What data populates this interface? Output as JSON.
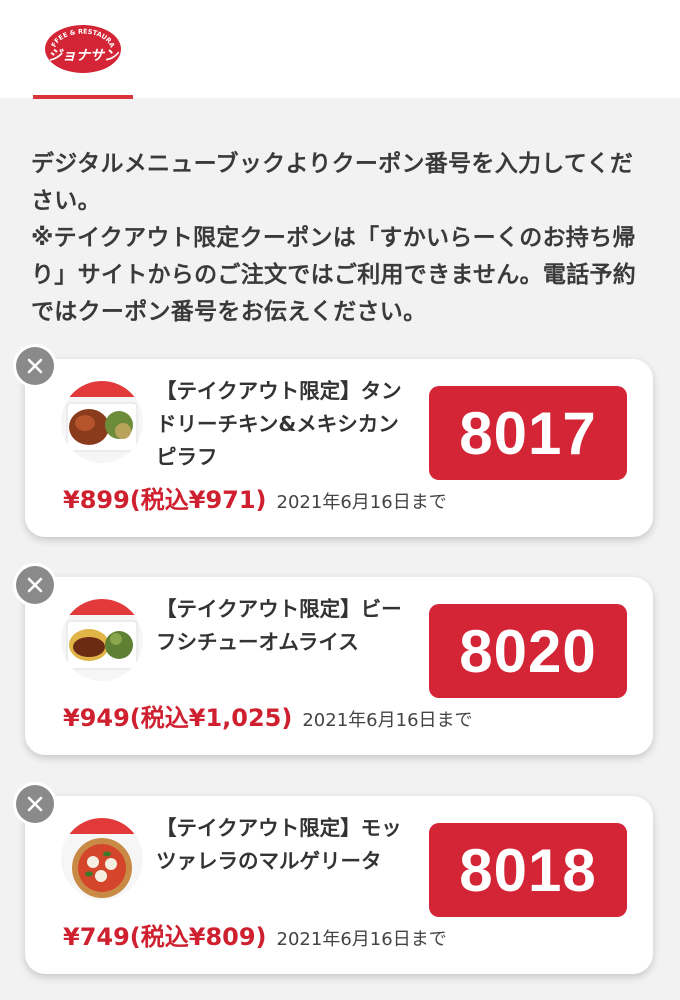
{
  "header": {
    "logo_top_text": "COFFEE & RESTAURANT",
    "logo_main_text": "ジョナサン"
  },
  "instructions": {
    "line1": "デジタルメニューブックよりクーポン番号を入力してください。",
    "line2": "※テイクアウト限定クーポンは「すかいらーくのお持ち帰り」サイトからのご注文ではご利用できません。電話予約ではクーポン番号をお伝えください。"
  },
  "coupons": [
    {
      "title": "【テイクアウト限定】タンドリーチキン&メキシカンピラフ",
      "code": "8017",
      "price": "¥899(税込¥971)",
      "deadline": "2021年6月16日まで",
      "thumb_icon": "chicken-pilaf-icon"
    },
    {
      "title": "【テイクアウト限定】ビーフシチューオムライス",
      "code": "8020",
      "price": "¥949(税込¥1,025)",
      "deadline": "2021年6月16日まで",
      "thumb_icon": "beef-stew-omurice-icon"
    },
    {
      "title": "【テイクアウト限定】モッツァレラのマルゲリータ",
      "code": "8018",
      "price": "¥749(税込¥809)",
      "deadline": "2021年6月16日まで",
      "thumb_icon": "margherita-pizza-icon"
    }
  ],
  "colors": {
    "accent": "#d42536",
    "price": "#cf2030",
    "close_button": "#8a8a8a",
    "background": "#f2f2f2"
  }
}
